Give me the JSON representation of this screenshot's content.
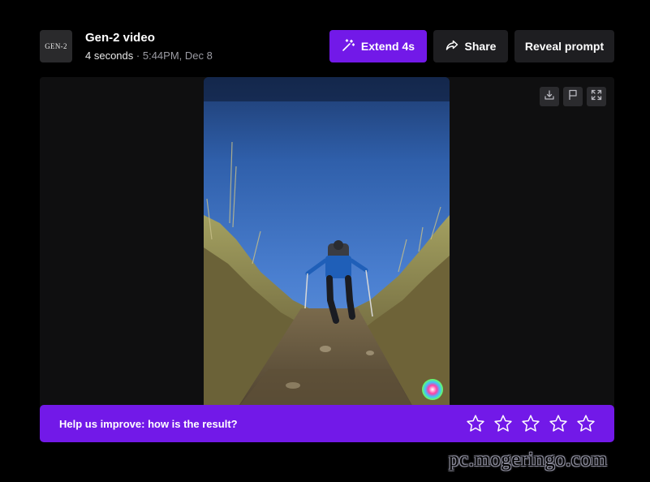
{
  "header": {
    "thumb_text": "GEN-2",
    "title": "Gen-2 video",
    "duration": "4 seconds",
    "separator": "·",
    "timestamp": "5:44PM, Dec 8"
  },
  "actions": {
    "extend_label": "Extend 4s",
    "share_label": "Share",
    "reveal_label": "Reveal prompt"
  },
  "video": {
    "icon": "hiker-video-frame"
  },
  "tools": {
    "icons": [
      "download-icon",
      "flag-icon",
      "expand-icon"
    ]
  },
  "feedback": {
    "label": "Help us improve: how is the result?",
    "stars_max": 5,
    "rating": 0
  },
  "watermark": "pc.mogeringo.com",
  "colors": {
    "accent": "#7219e8",
    "button_dark": "#1e1e21",
    "background": "#000000",
    "panel": "#0f0f10"
  }
}
